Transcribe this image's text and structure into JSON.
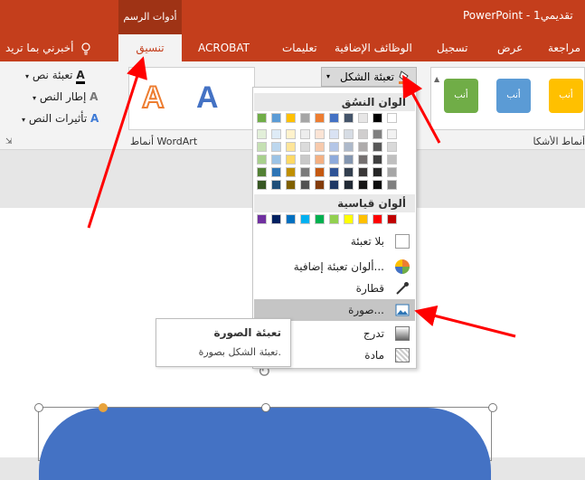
{
  "title_bar": {
    "context_label": "أدوات الرسم",
    "doc_title": "PowerPoint  -  تقديمي1"
  },
  "tabs": [
    "مراجعة",
    "عرض",
    "تسجيل",
    "الوظائف الإضافية",
    "تعليمات",
    "ACROBAT",
    "تنسيق",
    "أخبرني بما تريد"
  ],
  "ribbon": {
    "shape_fill": "تعبئة الشكل",
    "shape_style_label": "أنب",
    "shape_styles_group": "أنماط الأشكال",
    "text_fill": "تعبئة نص",
    "text_outline": "إطار النص",
    "text_effects": "تأثيرات النص",
    "wordart_group": "أنماط WordArt",
    "wordart_letter": "A"
  },
  "dropdown": {
    "theme_colors_header": "ألوان النسُق",
    "standard_colors_header": "ألوان قياسية",
    "theme_top_row": [
      "#ffffff",
      "#000000",
      "#e7e6e6",
      "#44546a",
      "#4472c4",
      "#ed7d31",
      "#a5a5a5",
      "#ffc000",
      "#5b9bd5",
      "#70ad47"
    ],
    "theme_shades": [
      [
        "#f2f2f2",
        "#808080",
        "#d0cece",
        "#d6dce4",
        "#d9e2f3",
        "#fbe4d5",
        "#ededed",
        "#fff2cc",
        "#deebf6",
        "#e2efd9"
      ],
      [
        "#d9d9d9",
        "#595959",
        "#aeabab",
        "#adb9ca",
        "#b4c6e7",
        "#f7caac",
        "#dbdbdb",
        "#fee599",
        "#bdd7ee",
        "#c5e0b3"
      ],
      [
        "#bfbfbf",
        "#404040",
        "#757070",
        "#8496b0",
        "#8eaadb",
        "#f4b183",
        "#c9c9c9",
        "#ffd965",
        "#9cc3e5",
        "#a8d08d"
      ],
      [
        "#a6a6a6",
        "#262626",
        "#3a3838",
        "#333f4f",
        "#2f5496",
        "#c45911",
        "#7b7b7b",
        "#bf8f00",
        "#2e75b5",
        "#538135"
      ],
      [
        "#7f7f7f",
        "#0d0d0d",
        "#171616",
        "#222a35",
        "#1f3864",
        "#833c0b",
        "#525252",
        "#7f6000",
        "#1e4e79",
        "#375623"
      ]
    ],
    "standard": [
      "#c00000",
      "#ff0000",
      "#ffc000",
      "#ffff00",
      "#92d050",
      "#00b050",
      "#00b0f0",
      "#0070c0",
      "#002060",
      "#7030a0"
    ],
    "items": {
      "no_fill": "بلا تعبئة",
      "more_colors": "ألوان تعبئة إضافية...",
      "eyedropper": "قطارة",
      "picture": "صورة...",
      "gradient": "تدرج",
      "texture": "مادة"
    }
  },
  "tooltip": {
    "title": "تعبئة الصورة",
    "body": "تعبئة الشكل بصورة."
  },
  "colors": {
    "accent": "#c43e1c",
    "shape_blue": "#4472c4",
    "handle_orange": "#e8a33c",
    "arrow_red": "#ff0000"
  }
}
